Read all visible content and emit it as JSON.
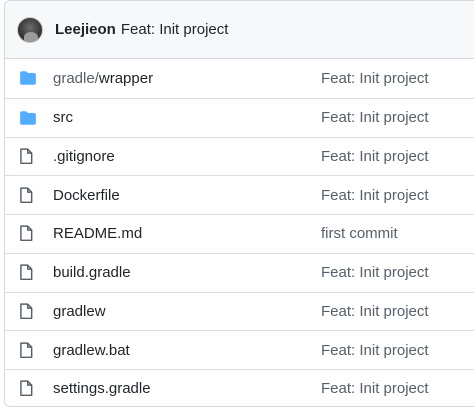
{
  "latest_commit": {
    "author": "Leejieon",
    "message": "Feat: Init project"
  },
  "files": [
    {
      "type": "folder",
      "name_prefix": "gradle/",
      "name": "wrapper",
      "message": "Feat: Init project"
    },
    {
      "type": "folder",
      "name_prefix": "",
      "name": "src",
      "message": "Feat: Init project"
    },
    {
      "type": "file",
      "name_prefix": "",
      "name": ".gitignore",
      "message": "Feat: Init project"
    },
    {
      "type": "file",
      "name_prefix": "",
      "name": "Dockerfile",
      "message": "Feat: Init project"
    },
    {
      "type": "file",
      "name_prefix": "",
      "name": "README.md",
      "message": "first commit"
    },
    {
      "type": "file",
      "name_prefix": "",
      "name": "build.gradle",
      "message": "Feat: Init project"
    },
    {
      "type": "file",
      "name_prefix": "",
      "name": "gradlew",
      "message": "Feat: Init project"
    },
    {
      "type": "file",
      "name_prefix": "",
      "name": "gradlew.bat",
      "message": "Feat: Init project"
    },
    {
      "type": "file",
      "name_prefix": "",
      "name": "settings.gradle",
      "message": "Feat: Init project"
    }
  ],
  "colors": {
    "folder": "#54aeff",
    "file_icon": "#57606a",
    "text": "#1f2328",
    "muted": "#57606a",
    "border": "#d0d7de",
    "header_bg": "#f6f8fa"
  }
}
